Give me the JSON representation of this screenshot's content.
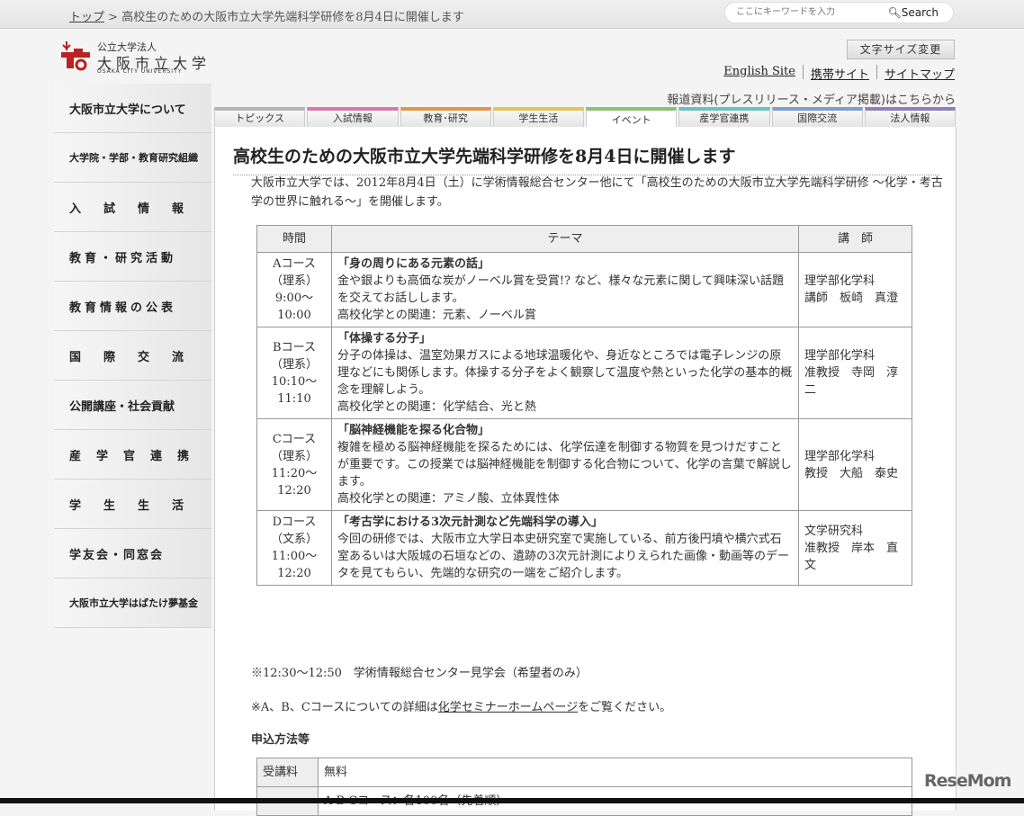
{
  "breadcrumb": {
    "home": "トップ",
    "sep": " > ",
    "current": "高校生のための大阪市立大学先端科学研修を8月4日に開催します"
  },
  "search": {
    "placeholder": "ここにキーワードを入力",
    "button": "Search"
  },
  "logo": {
    "line1": "公立大学法人",
    "line2": "大阪市立大学",
    "line3": "OSAKA CITY UNIVERSITY"
  },
  "header": {
    "font_size": "文字サイズ変更",
    "links": [
      "English Site",
      "携帯サイト",
      "サイトマップ"
    ],
    "press": "報道資料(プレスリリース・メディア掲載)はこちらから"
  },
  "sidebar": [
    "大阪市立大学について",
    "大学院・学部・教育研究組織",
    "入　試　情　報",
    "教育・研究活動",
    "教育情報の公表",
    "国　際　交　流",
    "公開講座・社会貢献",
    "産　学　官　連　携",
    "学　生　生　活",
    "学友会・同窓会",
    "大阪市立大学はばたけ夢基金"
  ],
  "tabs": [
    {
      "label": "トピックス",
      "color": "#b5b5b5"
    },
    {
      "label": "入試情報",
      "color": "#d77aa6"
    },
    {
      "label": "教育･研究",
      "color": "#e0964a"
    },
    {
      "label": "学生生活",
      "color": "#e2c45a"
    },
    {
      "label": "イベント",
      "color": "#8cc07a"
    },
    {
      "label": "産学官連携",
      "color": "#6cc0c0"
    },
    {
      "label": "国際交流",
      "color": "#7a9fd0"
    },
    {
      "label": "法人情報",
      "color": "#8e80b8"
    }
  ],
  "active_tab": "イベント",
  "article": {
    "title": "高校生のための大阪市立大学先端科学研修を8月4日に開催します",
    "intro": "大阪市立大学では、2012年8月4日（土）に学術情報総合センター他にて「高校生のための大阪市立大学先端科学研修 〜化学・考古学の世界に触れる〜」を開催します。",
    "table_headers": [
      "時間",
      "テーマ",
      "講　師"
    ],
    "rows": [
      {
        "course": "Aコース",
        "type": "（理系）",
        "time": "9:00〜10:00",
        "theme": "「身の周りにある元素の話」",
        "desc": "金や銀よりも高価な炭がノーベル賞を受賞!? など、様々な元素に関して興味深い話題を交えてお話しします。",
        "rel": "高校化学との関連：元素、ノーベル賞",
        "dept": "理学部化学科",
        "lecturer": "講師　板崎　真澄"
      },
      {
        "course": "Bコース",
        "type": "（理系）",
        "time": "10:10〜11:10",
        "theme": "「体操する分子」",
        "desc": "分子の体操は、温室効果ガスによる地球温暖化や、身近なところでは電子レンジの原理などにも関係します。体操する分子をよく観察して温度や熱といった化学の基本的概念を理解しよう。",
        "rel": "高校化学との関連：化学結合、光と熱",
        "dept": "理学部化学科",
        "lecturer": "准教授　寺岡　淳二"
      },
      {
        "course": "Cコース",
        "type": "（理系）",
        "time": "11:20〜12:20",
        "theme": "「脳神経機能を探る化合物」",
        "desc": "複雑を極める脳神経機能を探るためには、化学伝達を制御する物質を見つけだすことが重要です。この授業では脳神経機能を制御する化合物について、化学の言葉で解説します。",
        "rel": "高校化学との関連：アミノ酸、立体異性体",
        "dept": "理学部化学科",
        "lecturer": "教授　大船　泰史"
      },
      {
        "course": "Dコース",
        "type": "（文系）",
        "time": "11:00〜12:20",
        "theme": "「考古学における3次元計測など先端科学の導入」",
        "desc": "今回の研修では、大阪市立大学日本史研究室で実施している、前方後円墳や横穴式石室あるいは大阪城の石垣などの、遺跡の3次元計測によりえられた画像・動画等のデータを見てもらい、先端的な研究の一端をご紹介します。",
        "rel": "",
        "dept": "文学研究科",
        "lecturer": "准教授　岸本　直文"
      }
    ],
    "note1": "※12:30〜12:50　学術情報総合センター見学会（希望者のみ）",
    "note2_pre": "※A、B、Cコースについての詳細は",
    "note2_link": "化学セミナーホームページ",
    "note2_post": "をご覧ください。",
    "apply_heading": "申込方法等",
    "apply": [
      {
        "k": "受講料",
        "v": "無料"
      },
      {
        "k": "",
        "v": "A B Cコース：各100名（先着順）"
      }
    ]
  },
  "watermark": "ReseMom"
}
